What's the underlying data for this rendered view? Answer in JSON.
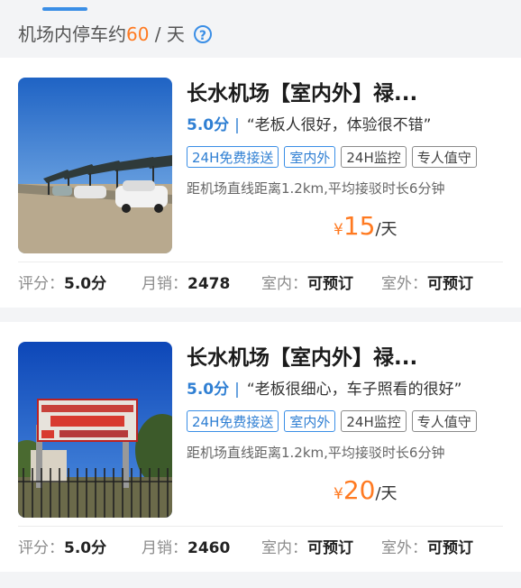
{
  "header": {
    "prefix": "机场内停车约",
    "amount": "60",
    "suffix": " / 天",
    "info_icon": "info-icon"
  },
  "colors": {
    "accent": "#3a8ee6",
    "price": "#ff7a21",
    "background": "#f3f4f6"
  },
  "listings": [
    {
      "title": "长水机场【室内外】禄...",
      "rating": "5.0分",
      "separator": "|",
      "review": "“老板人很好，体验很不错”",
      "tags": [
        "24H免费接送",
        "室内外",
        "24H监控",
        "专人值守"
      ],
      "distance": "距机场直线距离1.2km,平均接驳时长6分钟",
      "price_symbol": "¥",
      "price": "15",
      "price_unit": "/天",
      "stats": {
        "rating_label": "评分：",
        "rating_value": "5.0分",
        "sales_label": "月销：",
        "sales_value": "2478",
        "indoor_label": "室内：",
        "indoor_value": "可预订",
        "outdoor_label": "室外：",
        "outdoor_value": "可预订"
      }
    },
    {
      "title": "长水机场【室内外】禄...",
      "rating": "5.0分",
      "separator": "|",
      "review": "“老板很细心，车子照看的很好”",
      "tags": [
        "24H免费接送",
        "室内外",
        "24H监控",
        "专人值守"
      ],
      "distance": "距机场直线距离1.2km,平均接驳时长6分钟",
      "price_symbol": "¥",
      "price": "20",
      "price_unit": "/天",
      "stats": {
        "rating_label": "评分：",
        "rating_value": "5.0分",
        "sales_label": "月销：",
        "sales_value": "2460",
        "indoor_label": "室内：",
        "indoor_value": "可预订",
        "outdoor_label": "室外：",
        "outdoor_value": "可预订"
      }
    }
  ]
}
